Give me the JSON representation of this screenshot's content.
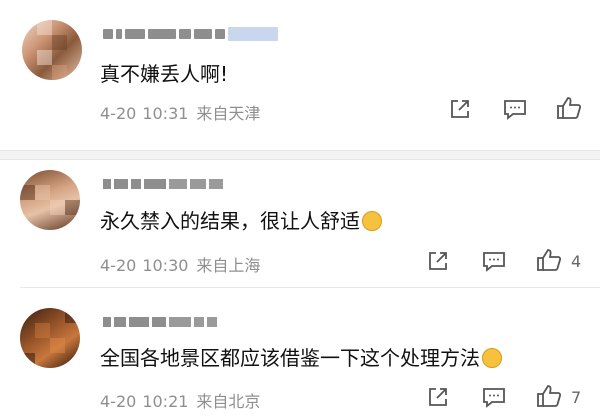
{
  "comments": [
    {
      "text": "真不嫌丢人啊!",
      "date": "4-20",
      "time": "10:31",
      "location": "来自天津",
      "likes": ""
    },
    {
      "text": "永久禁入的结果，很让人舒适",
      "date": "4-20",
      "time": "10:30",
      "location": "来自上海",
      "likes": "4"
    },
    {
      "text": "全国各地景区都应该借鉴一下这个处理方法",
      "date": "4-20",
      "time": "10:21",
      "location": "来自北京",
      "likes": "7"
    }
  ],
  "icons": {
    "share": "share-icon",
    "reply": "comment-icon",
    "like": "thumbs-up-icon"
  },
  "colors": {
    "meta": "#8f8f8f",
    "icon": "#555555",
    "background": "#ffffff"
  }
}
